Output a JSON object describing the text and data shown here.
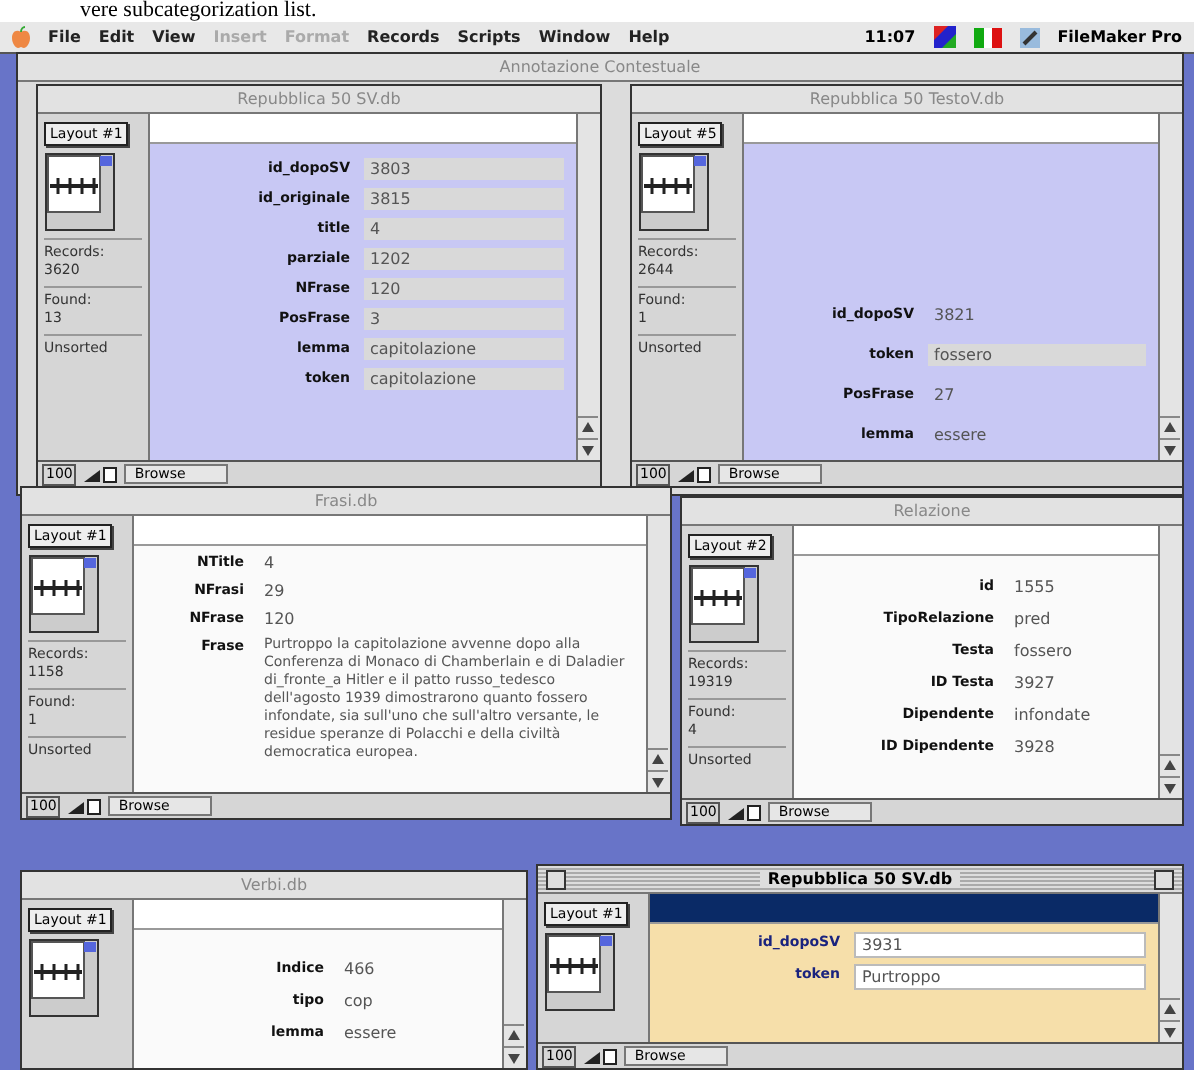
{
  "document_text": "vere subcategorization list.",
  "menu_bar": {
    "menus": [
      {
        "label": "File",
        "disabled": false
      },
      {
        "label": "Edit",
        "disabled": false
      },
      {
        "label": "View",
        "disabled": false
      },
      {
        "label": "Insert",
        "disabled": true
      },
      {
        "label": "Format",
        "disabled": true
      },
      {
        "label": "Records",
        "disabled": false
      },
      {
        "label": "Scripts",
        "disabled": false
      },
      {
        "label": "Window",
        "disabled": false
      },
      {
        "label": "Help",
        "disabled": false
      }
    ],
    "time": "11:07",
    "app": "FileMaker Pro"
  },
  "windows": [
    {
      "title": "Annotazione Contestuale",
      "active": false
    },
    {
      "title": "Repubblica 50 SV.db",
      "active": false,
      "color": "#c8c8f4",
      "sidebar": {
        "layout": "Layout #1",
        "records_label": "Records:",
        "records": "3620",
        "found_label": "Found:",
        "found": "13",
        "sort": "Unsorted"
      },
      "zoom": "100",
      "mode": "Browse",
      "fields": [
        {
          "label": "id_dopoSV",
          "value": "3803",
          "kind": "boxed"
        },
        {
          "label": "id_originale",
          "value": "3815",
          "kind": "boxed"
        },
        {
          "label": "title",
          "value": "4",
          "kind": "boxed"
        },
        {
          "label": "parziale",
          "value": "1202",
          "kind": "boxed"
        },
        {
          "label": "NFrase",
          "value": "120",
          "kind": "boxed"
        },
        {
          "label": "PosFrase",
          "value": "3",
          "kind": "boxed"
        },
        {
          "label": "lemma",
          "value": "capitolazione",
          "kind": "boxed"
        },
        {
          "label": "token",
          "value": "capitolazione",
          "kind": "boxed"
        }
      ]
    },
    {
      "title": "Repubblica 50 TestoV.db",
      "active": false,
      "color": "#c8c8f4",
      "sidebar": {
        "layout": "Layout #5",
        "records_label": "Records:",
        "records": "2644",
        "found_label": "Found:",
        "found": "1",
        "sort": "Unsorted"
      },
      "zoom": "100",
      "mode": "Browse",
      "fields": [
        {
          "label": "id_dopoSV",
          "value": "3821",
          "kind": "plain"
        },
        {
          "label": "token",
          "value": "fossero",
          "kind": "boxed"
        },
        {
          "label": "PosFrase",
          "value": "27",
          "kind": "plain"
        },
        {
          "label": "lemma",
          "value": "essere",
          "kind": "plain"
        }
      ]
    },
    {
      "title": "Frasi.db",
      "active": false,
      "color": "#fafafa",
      "sidebar": {
        "layout": "Layout #1",
        "records_label": "Records:",
        "records": "1158",
        "found_label": "Found:",
        "found": "1",
        "sort": "Unsorted"
      },
      "zoom": "100",
      "mode": "Browse",
      "fields": [
        {
          "label": "NTitle",
          "value": "4",
          "kind": "plain"
        },
        {
          "label": "NFrasi",
          "value": "29",
          "kind": "plain"
        },
        {
          "label": "NFrase",
          "value": "120",
          "kind": "plain"
        },
        {
          "label": "Frase",
          "value": "Purtroppo la capitolazione avvenne dopo alla Conferenza di Monaco di Chamberlain e di Daladier di_fronte_a Hitler e il patto russo_tedesco dell'agosto 1939 dimostrarono quanto fossero infondate, sia sull'uno che sull'altro versante, le residue speranze di Polacchi e della civiltà democratica europea.",
          "kind": "paragraph"
        }
      ]
    },
    {
      "title": "Relazione",
      "active": false,
      "color": "#fafafa",
      "sidebar": {
        "layout": "Layout #2",
        "records_label": "Records:",
        "records": "19319",
        "found_label": "Found:",
        "found": "4",
        "sort": "Unsorted"
      },
      "zoom": "100",
      "mode": "Browse",
      "fields": [
        {
          "label": "id",
          "value": "1555",
          "kind": "plain"
        },
        {
          "label": "TipoRelazione",
          "value": "pred",
          "kind": "plain"
        },
        {
          "label": "Testa",
          "value": "fossero",
          "kind": "plain"
        },
        {
          "label": "ID Testa",
          "value": "3927",
          "kind": "plain"
        },
        {
          "label": "Dipendente",
          "value": "infondate",
          "kind": "plain"
        },
        {
          "label": "ID Dipendente",
          "value": "3928",
          "kind": "plain"
        }
      ]
    },
    {
      "title": "Verbi.db",
      "active": false,
      "color": "#fafafa",
      "sidebar": {
        "layout": "Layout #1"
      },
      "fields": [
        {
          "label": "Indice",
          "value": "466",
          "kind": "plain"
        },
        {
          "label": "tipo",
          "value": "cop",
          "kind": "plain"
        },
        {
          "label": "lemma",
          "value": "essere",
          "kind": "plain"
        }
      ]
    },
    {
      "title": "Repubblica 50 SV.db",
      "active": true,
      "color": "#f6dfaa",
      "sidebar": {
        "layout": "Layout #1"
      },
      "zoom": "100",
      "mode": "Browse",
      "fields": [
        {
          "label": "id_dopoSV",
          "value": "3931",
          "kind": "white"
        },
        {
          "label": "token",
          "value": "Purtroppo",
          "kind": "white"
        }
      ]
    }
  ]
}
